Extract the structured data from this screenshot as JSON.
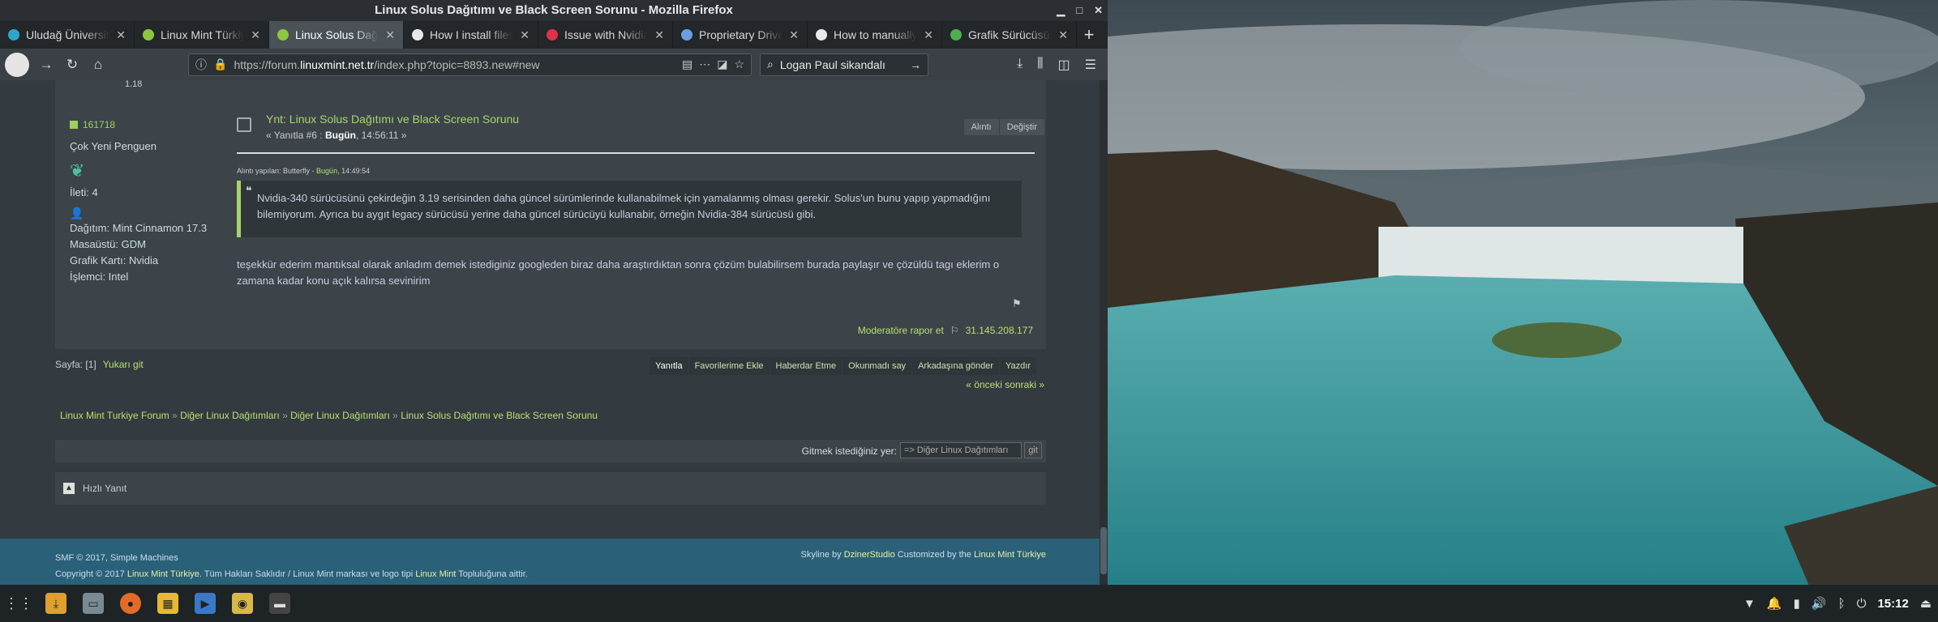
{
  "window": {
    "title": "Linux Solus Dağıtımı ve Black Screen Sorunu - Mozilla Firefox"
  },
  "tabs": [
    {
      "label": "Uludağ Üniversitesi",
      "color": "#2aa7c9"
    },
    {
      "label": "Linux Mint Türkiye",
      "color": "#8dc63f"
    },
    {
      "label": "Linux Solus Dağıtımı",
      "color": "#8dc63f",
      "active": true
    },
    {
      "label": "How I install files",
      "color": "#e8e8e8"
    },
    {
      "label": "Issue with Nvidia",
      "color": "#e0304a"
    },
    {
      "label": "Proprietary Drivers",
      "color": "#6aa0e0"
    },
    {
      "label": "How to manually",
      "color": "#e8e8e8"
    },
    {
      "label": "Grafik Sürücüsü",
      "color": "#4caf50"
    }
  ],
  "nav": {
    "url_prefix": "https://forum.",
    "url_domain": "linuxmint.net.tr",
    "url_suffix": "/index.php?topic=8893.new#new",
    "search_value": "Logan Paul sikandalı"
  },
  "topnum": "1.18",
  "user": {
    "name": "161718",
    "rank": "Çok Yeni Penguen",
    "posts": "İleti: 4",
    "sig": [
      "Dağıtım: Mint Cinnamon 17.3",
      "Masaüstü: GDM",
      "Grafik Kartı: Nvidia",
      "İşlemci: Intel"
    ]
  },
  "post": {
    "title": "Ynt: Linux Solus Dağıtımı ve Black Screen Sorunu",
    "meta_prefix": "« Yanıtla #6 : ",
    "meta_bold": "Bugün",
    "meta_suffix": ", 14:56:11 »",
    "btn_quote": "Alıntı",
    "btn_edit": "Değiştir",
    "quote_by_prefix": "Alıntı yapılan: Butterfly - ",
    "quote_by_day": "Bugün",
    "quote_by_time": ", 14:49:54",
    "quote_text_1": "Nvidia-340 sürücüsünü çekirdeğin 3.19 serisinden daha güncel sürümlerinde kullanabilmek için yamalanmış olması gerekir. Solus'un bunu yapıp yapmadığını",
    "quote_text_2": "bilemiyorum. Ayrıca bu aygıt legacy sürücüsü yerine daha güncel sürücüyü kullanabir, örneğin Nvidia-384 sürücüsü gibi.",
    "body_1": "teşekkür ederim mantıksal olarak anladım demek istediginiz googleden biraz daha araştırdıktan sonra çözüm bulabilirsem burada paylaşır ve çözüldü tagı eklerim o",
    "body_2": "zamana kadar konu açık kalırsa sevinirim",
    "report": "Moderatöre rapor et",
    "ip": "31.145.208.177"
  },
  "pager": {
    "pages": "Sayfa: [1]",
    "go_up": "Yukarı git",
    "actions": [
      "Yanıtla",
      "Favorilerime Ekle",
      "Haberdar Etme",
      "Okunmadı say",
      "Arkadaşına gönder",
      "Yazdır"
    ],
    "prevnext": "« önceki sonraki »"
  },
  "breadcrumb": [
    "Linux Mint Turkiye Forum",
    "Diğer Linux Dağıtımları",
    "Diğer Linux Dağıtımları",
    "Linux Solus Dağıtımı ve Black Screen Sorunu"
  ],
  "jump": {
    "label": "Gitmek istediğiniz yer:",
    "select": "=> Diğer Linux Dağıtımları",
    "go": "git"
  },
  "quickreply": "Hızlı Yanıt",
  "footer": {
    "smf": "SMF © 2017, Simple Machines",
    "copy_1": "Copyright © 2017 ",
    "copy_brand": "Linux Mint Türkiye",
    "copy_2": ". Tüm Hakları Saklıdır / Linux Mint markası ve logo tipi ",
    "copy_brand2": "Linux Mint",
    "copy_3": " Topluluğuna aittir.",
    "right_1": "Skyline by ",
    "right_brand": "DzinerStudio",
    "right_2": " Customized by the ",
    "right_brand2": "Linux Mint Türkiye"
  },
  "taskbar": {
    "clock": "15:12"
  }
}
